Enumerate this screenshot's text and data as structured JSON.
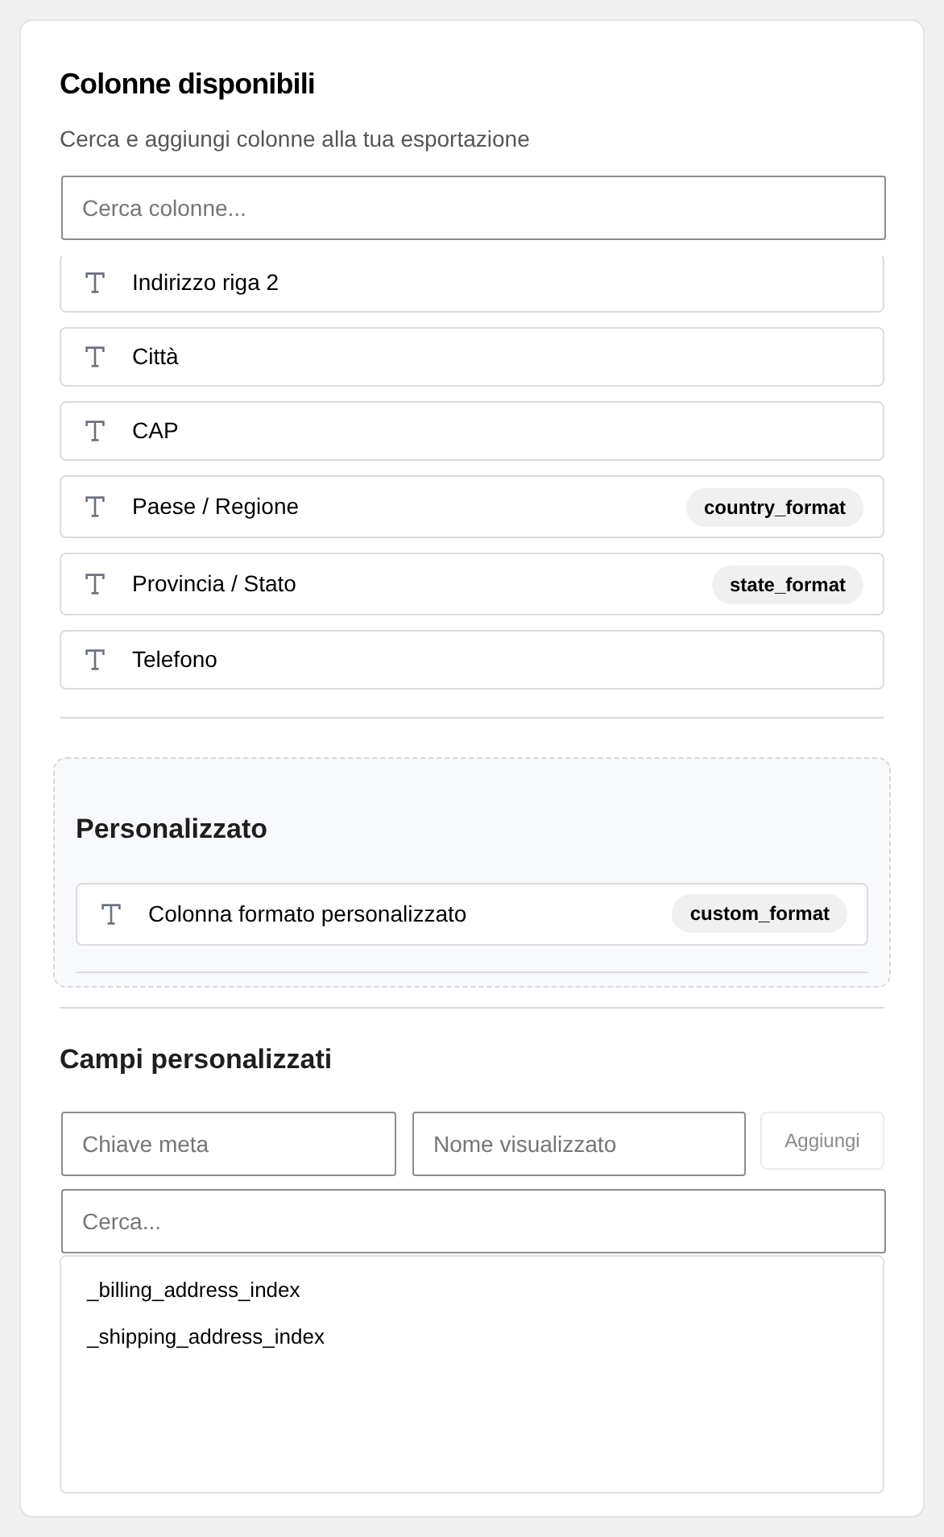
{
  "title": "Colonne disponibili",
  "subtitle": "Cerca e aggiungi colonne alla tua esportazione",
  "search": {
    "placeholder": "Cerca colonne..."
  },
  "columns": [
    {
      "label": "Indirizzo riga 2"
    },
    {
      "label": "Città"
    },
    {
      "label": "CAP"
    },
    {
      "label": "Paese / Regione",
      "badge": "country_format"
    },
    {
      "label": "Provincia / Stato",
      "badge": "state_format"
    },
    {
      "label": "Telefono"
    }
  ],
  "custom_section": {
    "title": "Personalizzato",
    "items": [
      {
        "label": "Colonna formato personalizzato",
        "badge": "custom_format"
      }
    ]
  },
  "custom_fields": {
    "title": "Campi personalizzati",
    "meta_key": {
      "placeholder": "Chiave meta"
    },
    "display_name": {
      "placeholder": "Nome visualizzato"
    },
    "add_button": "Aggiungi",
    "search": {
      "placeholder": "Cerca..."
    },
    "results": [
      "_billing_address_index",
      "_shipping_address_index"
    ]
  }
}
